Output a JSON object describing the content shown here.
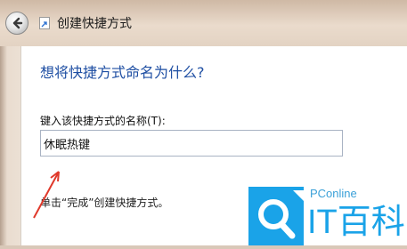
{
  "window": {
    "title": "创建快捷方式"
  },
  "main": {
    "question": "想将快捷方式命名为什么?",
    "name_label": "键入该快捷方式的名称(T):",
    "name_value": "休眠热键",
    "hint": "单击“完成”创建快捷方式。"
  },
  "watermark": {
    "brand_small": "PConline",
    "brand_large": "IT百科"
  },
  "colors": {
    "question_text": "#1f4fa3",
    "annotation_arrow": "#e0392b",
    "logo_blue": "#1aa3e8"
  }
}
